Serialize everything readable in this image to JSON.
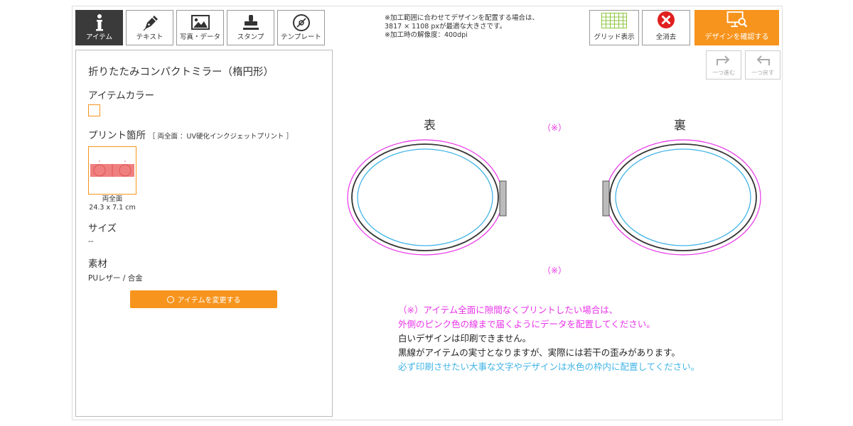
{
  "tabs": [
    {
      "label": "アイテム",
      "icon": "info-icon",
      "active": true
    },
    {
      "label": "テキスト",
      "icon": "pen-icon"
    },
    {
      "label": "写真・データ",
      "icon": "image-icon"
    },
    {
      "label": "スタンプ",
      "icon": "stamp-icon"
    },
    {
      "label": "テンプレート",
      "icon": "template-icon"
    }
  ],
  "top_note": [
    "※加工範囲に合わせてデザインを配置する場合は、",
    "3817 × 1108 pxが最適な大きさです。",
    "※加工時の解像度：400dpi"
  ],
  "toolbar": {
    "grid_label": "グリッド表示",
    "clear_label": "全消去",
    "confirm_label": "デザインを確認する",
    "redo_label": "一つ進む",
    "undo_label": "一つ戻す"
  },
  "panel": {
    "item_name": "折りたたみコンパクトミラー（楕円形）",
    "color_heading": "アイテムカラー",
    "print_heading": "プリント箇所",
    "print_sub": "［ 両全面 ：UV硬化インクジェットプリント ］",
    "print_area_name": "両全面",
    "print_area_size": "24.3 x 7.1 cm",
    "size_heading": "サイズ",
    "size_value": "--",
    "material_heading": "素材",
    "material_value": "PUレザー / 合金",
    "change_button": "アイテムを変更する"
  },
  "canvas": {
    "front_label": "表",
    "back_label": "裏",
    "asterisk_top": "（※）",
    "asterisk_bottom": "（※）"
  },
  "notes": {
    "line1": "（※）アイテム全面に隙間なくプリントしたい場合は、",
    "line2": "外側のピンク色の線まで届くようにデータを配置してください。",
    "line3": "白いデザインは印刷できません。",
    "line4": "黒線がアイテムの実寸となりますが、実際には若干の歪みがあります。",
    "line5": "必ず印刷させたい大事な文字やデザインは水色の枠内に配置してください。"
  },
  "colors": {
    "accent": "#f7941d",
    "pink_guide": "#e834e8",
    "blue_guide": "#41b4e6",
    "dark_tab": "#3a3a3a",
    "clear_red": "#e02020",
    "grid_green": "#8dc63f"
  }
}
